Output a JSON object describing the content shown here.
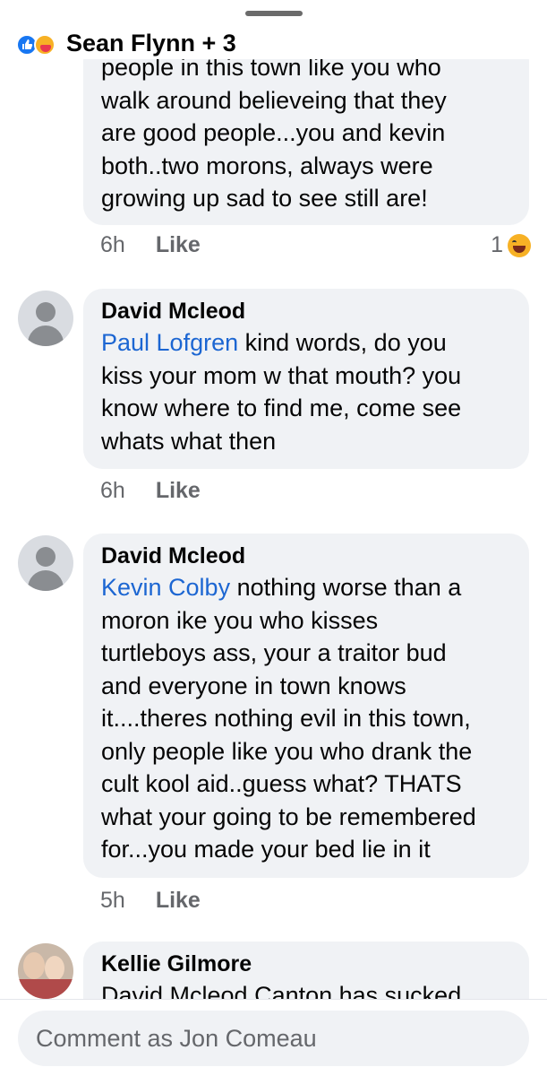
{
  "header": {
    "title": "Sean Flynn + 3"
  },
  "comments": [
    {
      "lines": [
        "people in this town like you who",
        "walk around believeing that they",
        "are good people...you and kevin",
        "both..two morons, always were",
        "growing up sad to see still are!"
      ],
      "time": "6h",
      "like": "Like",
      "reaction_count": "1"
    },
    {
      "author": "David Mcleod",
      "mention": "Paul Lofgren",
      "first_rest": " kind words, do you",
      "lines": [
        "kiss your mom w that mouth? you",
        "know where to find me, come see",
        "whats what then"
      ],
      "time": "6h",
      "like": "Like"
    },
    {
      "author": "David Mcleod",
      "mention": "Kevin Colby",
      "first_rest": " nothing worse than a",
      "lines": [
        "moron ike you who kisses",
        "turtleboys ass, your a traitor bud",
        "and everyone in town knows",
        "it....theres nothing evil in this town,",
        "only people like you who drank the",
        "cult kool aid..guess what? THATS",
        "what your going to be remembered",
        "for...you made your bed lie in it"
      ],
      "time": "5h",
      "like": "Like"
    },
    {
      "author": "Kellie Gilmore",
      "lines": [
        "David Mcleod Canton has sucked"
      ]
    }
  ],
  "composer": {
    "placeholder": "Comment as Jon Comeau"
  },
  "colors": {
    "bubble": "#f0f2f5",
    "mention": "#1c66d2",
    "meta": "#65676b",
    "like_reaction": "#1877f2"
  }
}
